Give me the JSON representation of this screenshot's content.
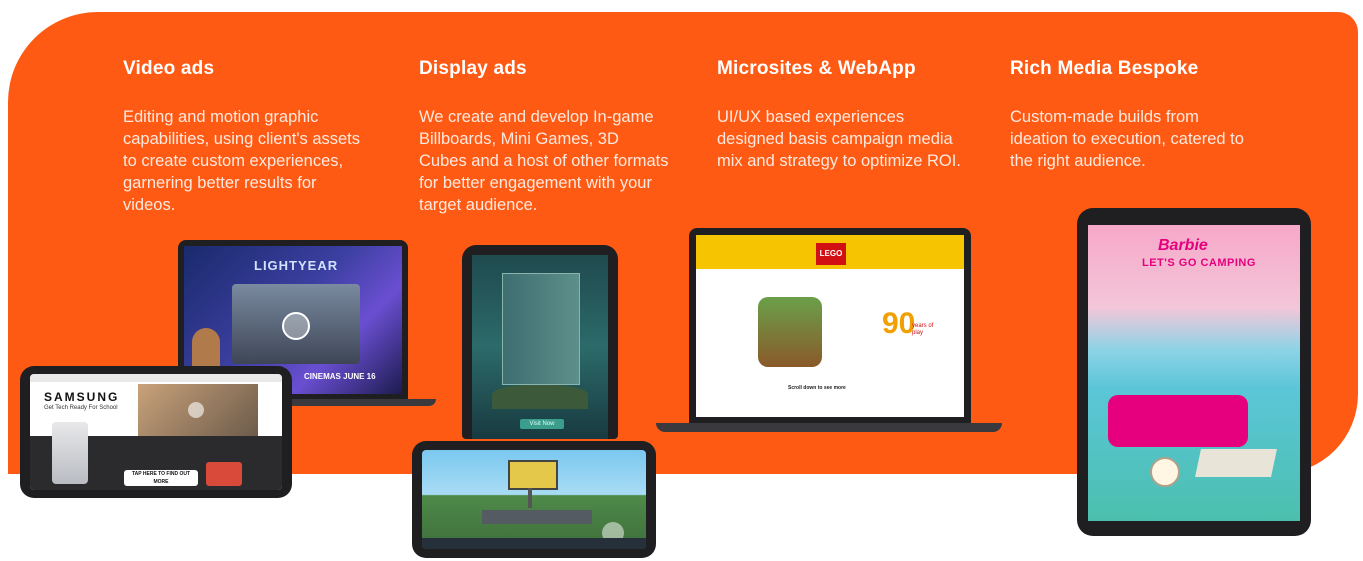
{
  "columns": [
    {
      "title": "Video ads",
      "body": "Editing and motion graphic capabilities, using client's assets to create custom experiences, garnering better results for videos."
    },
    {
      "title": "Display ads",
      "body": "We create and develop In-game Billboards, Mini Games, 3D Cubes and a host of other formats for better engagement with your target audience."
    },
    {
      "title": "Microsites & WebApp",
      "body": "UI/UX based experiences designed basis campaign media mix and strategy to optimize ROI."
    },
    {
      "title": "Rich Media Bespoke",
      "body": "Custom-made builds from ideation to execution, catered to the right audience."
    }
  ],
  "devices": {
    "laptop1": {
      "logo": "LIGHTYEAR",
      "caption": "CINEMAS JUNE 16"
    },
    "phone1": {
      "brand": "SAMSUNG",
      "tagline": "Get Tech Ready For School",
      "cta": "TAP HERE TO FIND OUT MORE"
    },
    "phone2": {
      "cta": "Visit Now"
    },
    "laptop2": {
      "logo": "LEGO",
      "years_number": "90",
      "years_label": "years of play",
      "scroll_hint": "Scroll down to see more"
    },
    "tablet": {
      "title_line1": "Barbie",
      "title_line2": "LET'S GO CAMPING"
    }
  },
  "colors": {
    "accent": "#ff5a14",
    "device": "#1f1f22"
  }
}
